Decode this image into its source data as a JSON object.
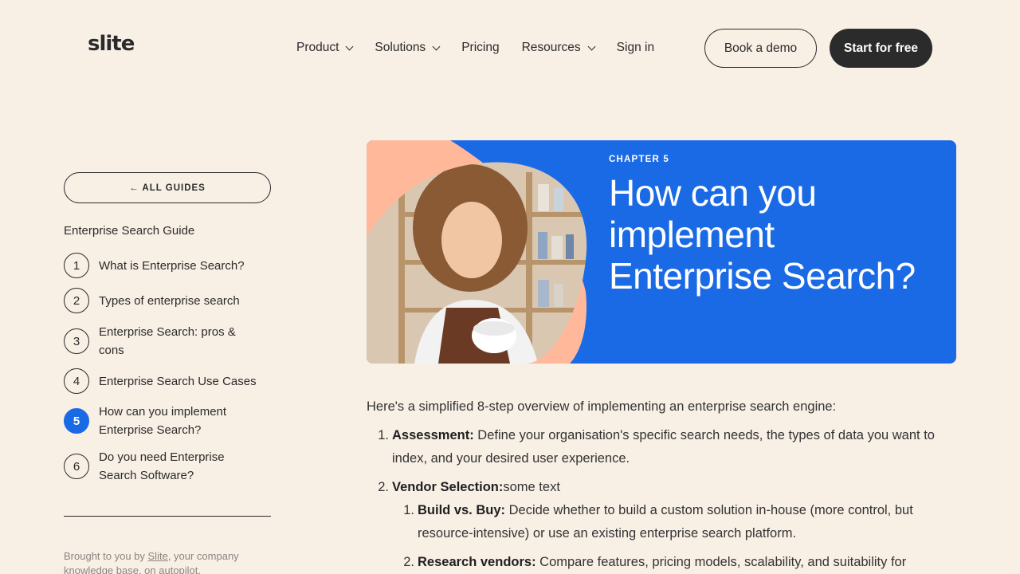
{
  "header": {
    "logo": "slite",
    "nav": [
      {
        "label": "Product",
        "dropdown": true
      },
      {
        "label": "Solutions",
        "dropdown": true
      },
      {
        "label": "Pricing",
        "dropdown": false
      },
      {
        "label": "Resources",
        "dropdown": true
      },
      {
        "label": "Sign in",
        "dropdown": false
      }
    ],
    "book_demo": "Book a demo",
    "start_free": "Start for free"
  },
  "sidebar": {
    "all_guides": "← ALL GUIDES",
    "guide_title": "Enterprise Search Guide",
    "items": [
      {
        "num": "1",
        "label": "What is Enterprise Search?",
        "active": false
      },
      {
        "num": "2",
        "label": "Types of enterprise search",
        "active": false
      },
      {
        "num": "3",
        "label": "Enterprise Search: pros & cons",
        "active": false
      },
      {
        "num": "4",
        "label": "Enterprise Search Use Cases",
        "active": false
      },
      {
        "num": "5",
        "label": "How can you implement Enterprise Search?",
        "active": true
      },
      {
        "num": "6",
        "label": "Do you need Enterprise Search Software?",
        "active": false
      }
    ],
    "brought_prefix": "Brought to you by ",
    "brought_link": "Slite",
    "brought_suffix": ", your company knowledge base, on autopilot."
  },
  "hero": {
    "chapter": "CHAPTER 5",
    "title": "How can you implement Enterprise Search?"
  },
  "article": {
    "intro": "Here's a simplified 8-step overview of implementing an enterprise search engine:",
    "steps": [
      {
        "num": "1.",
        "bold": "Assessment:",
        "text": " Define your organisation's specific search needs, the types of data you want to index, and your desired user experience."
      },
      {
        "num": "2.",
        "bold": "Vendor Selection:",
        "text": "some text"
      }
    ],
    "substeps": [
      {
        "num": "1.",
        "bold": "Build vs. Buy:",
        "text": " Decide whether to build a custom solution in-house (more control, but resource-intensive) or use an existing enterprise search platform."
      },
      {
        "num": "2.",
        "bold": "Research vendors:",
        "text": " Compare features, pricing models, scalability, and suitability for"
      }
    ]
  },
  "colors": {
    "background": "#f8efe5",
    "accent_blue": "#1a6ae6",
    "dark": "#2b2b2b",
    "peach": "#ffb89a"
  }
}
